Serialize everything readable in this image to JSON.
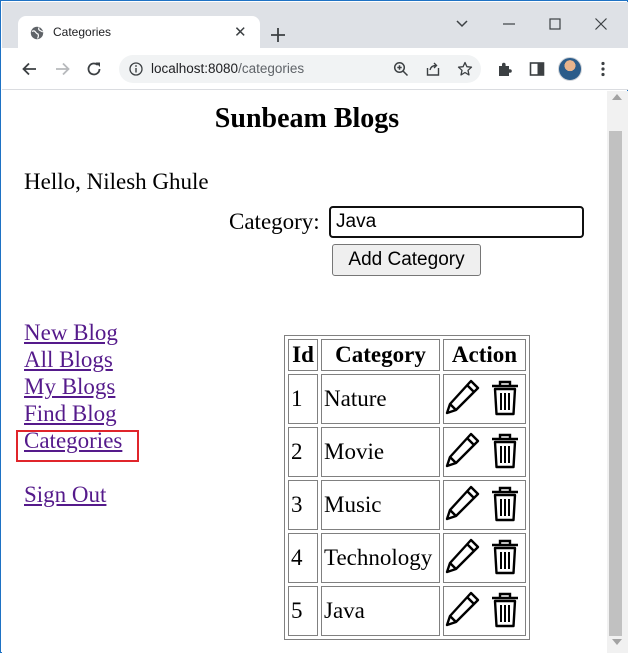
{
  "browser": {
    "tab_title": "Categories",
    "tab_close": "✕",
    "url_host": "localhost:8080",
    "url_path": "/categories"
  },
  "page": {
    "title": "Sunbeam Blogs",
    "greeting": "Hello, Nilesh Ghule",
    "category_label": "Category:",
    "category_value": "Java",
    "add_button": "Add Category"
  },
  "nav": {
    "new_blog": "New Blog",
    "all_blogs": "All Blogs",
    "my_blogs": "My Blogs",
    "find_blog": "Find Blog",
    "categories": "Categories",
    "sign_out": "Sign Out"
  },
  "table": {
    "headers": [
      "Id",
      "Category",
      "Action"
    ],
    "rows": [
      {
        "id": "1",
        "name": "Nature"
      },
      {
        "id": "2",
        "name": "Movie"
      },
      {
        "id": "3",
        "name": "Music"
      },
      {
        "id": "4",
        "name": "Technology"
      },
      {
        "id": "5",
        "name": "Java"
      }
    ]
  },
  "icons": {
    "edit": "pencil-icon",
    "delete": "trash-icon"
  },
  "colors": {
    "link_visited": "#551a8b",
    "highlight_box": "#e0252b",
    "tabstrip": "#dee1e6"
  }
}
